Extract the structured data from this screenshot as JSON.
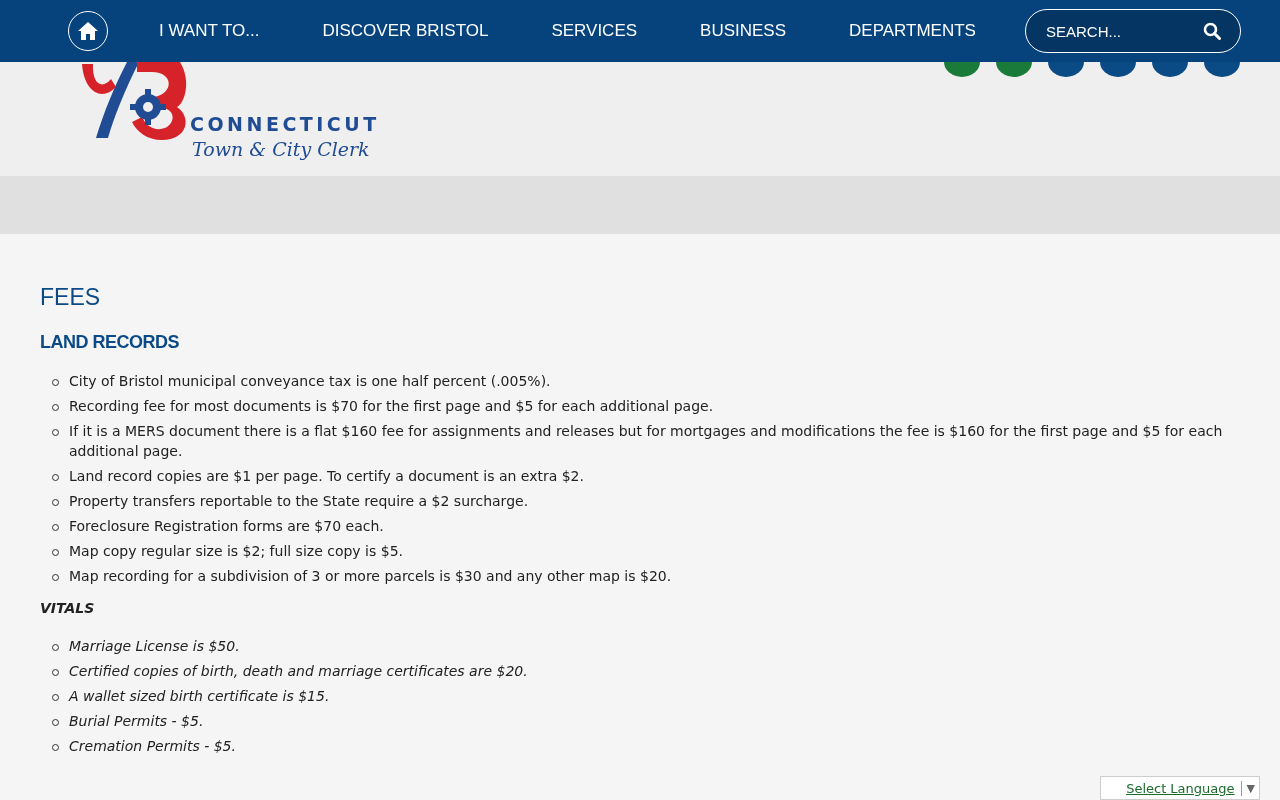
{
  "nav": {
    "items": [
      "I WANT TO...",
      "DISCOVER BRISTOL",
      "SERVICES",
      "BUSINESS",
      "DEPARTMENTS"
    ],
    "search": {
      "placeholder": "SEARCH..."
    }
  },
  "logo": {
    "state": "CONNECTICUT",
    "office": "Town & City Clerk"
  },
  "social_icons": [
    {
      "color": "#1a7a3a"
    },
    {
      "color": "#1a7a3a"
    },
    {
      "color": "#0a4a85"
    },
    {
      "color": "#0a4a85"
    },
    {
      "color": "#0a4a85"
    },
    {
      "color": "#0a4a85"
    }
  ],
  "title": "FEES",
  "sections": [
    {
      "heading": "LAND RECORDS",
      "kind": "heading",
      "items": [
        "City of Bristol municipal conveyance tax is one half percent (.005%).",
        "Recording fee for most documents is $70 for the first page and $5 for each additional page.",
        "If it is a MERS document there is a flat $160 fee for assignments and releases but for mortgages and modifications the fee is $160 for the first page and $5 for each additional page.",
        "Land record copies are $1 per page.  To certify a document is an extra $2.",
        "Property transfers reportable to the State require a $2 surcharge.",
        "Foreclosure Registration forms are $70 each.",
        "Map copy regular size is $2; full size copy is $5.",
        "Map recording for a subdivision of 3 or more parcels is $30 and any other map is $20."
      ]
    },
    {
      "heading": "VITALS",
      "kind": "italic",
      "items": [
        "Marriage License is $50.",
        "Certified copies of birth, death and marriage certificates are $20.",
        "A wallet sized birth certificate is $15.",
        "Burial Permits - $5.",
        "Cremation Permits - $5."
      ]
    }
  ],
  "language": {
    "label": "Select Language",
    "arrow": "▼"
  }
}
